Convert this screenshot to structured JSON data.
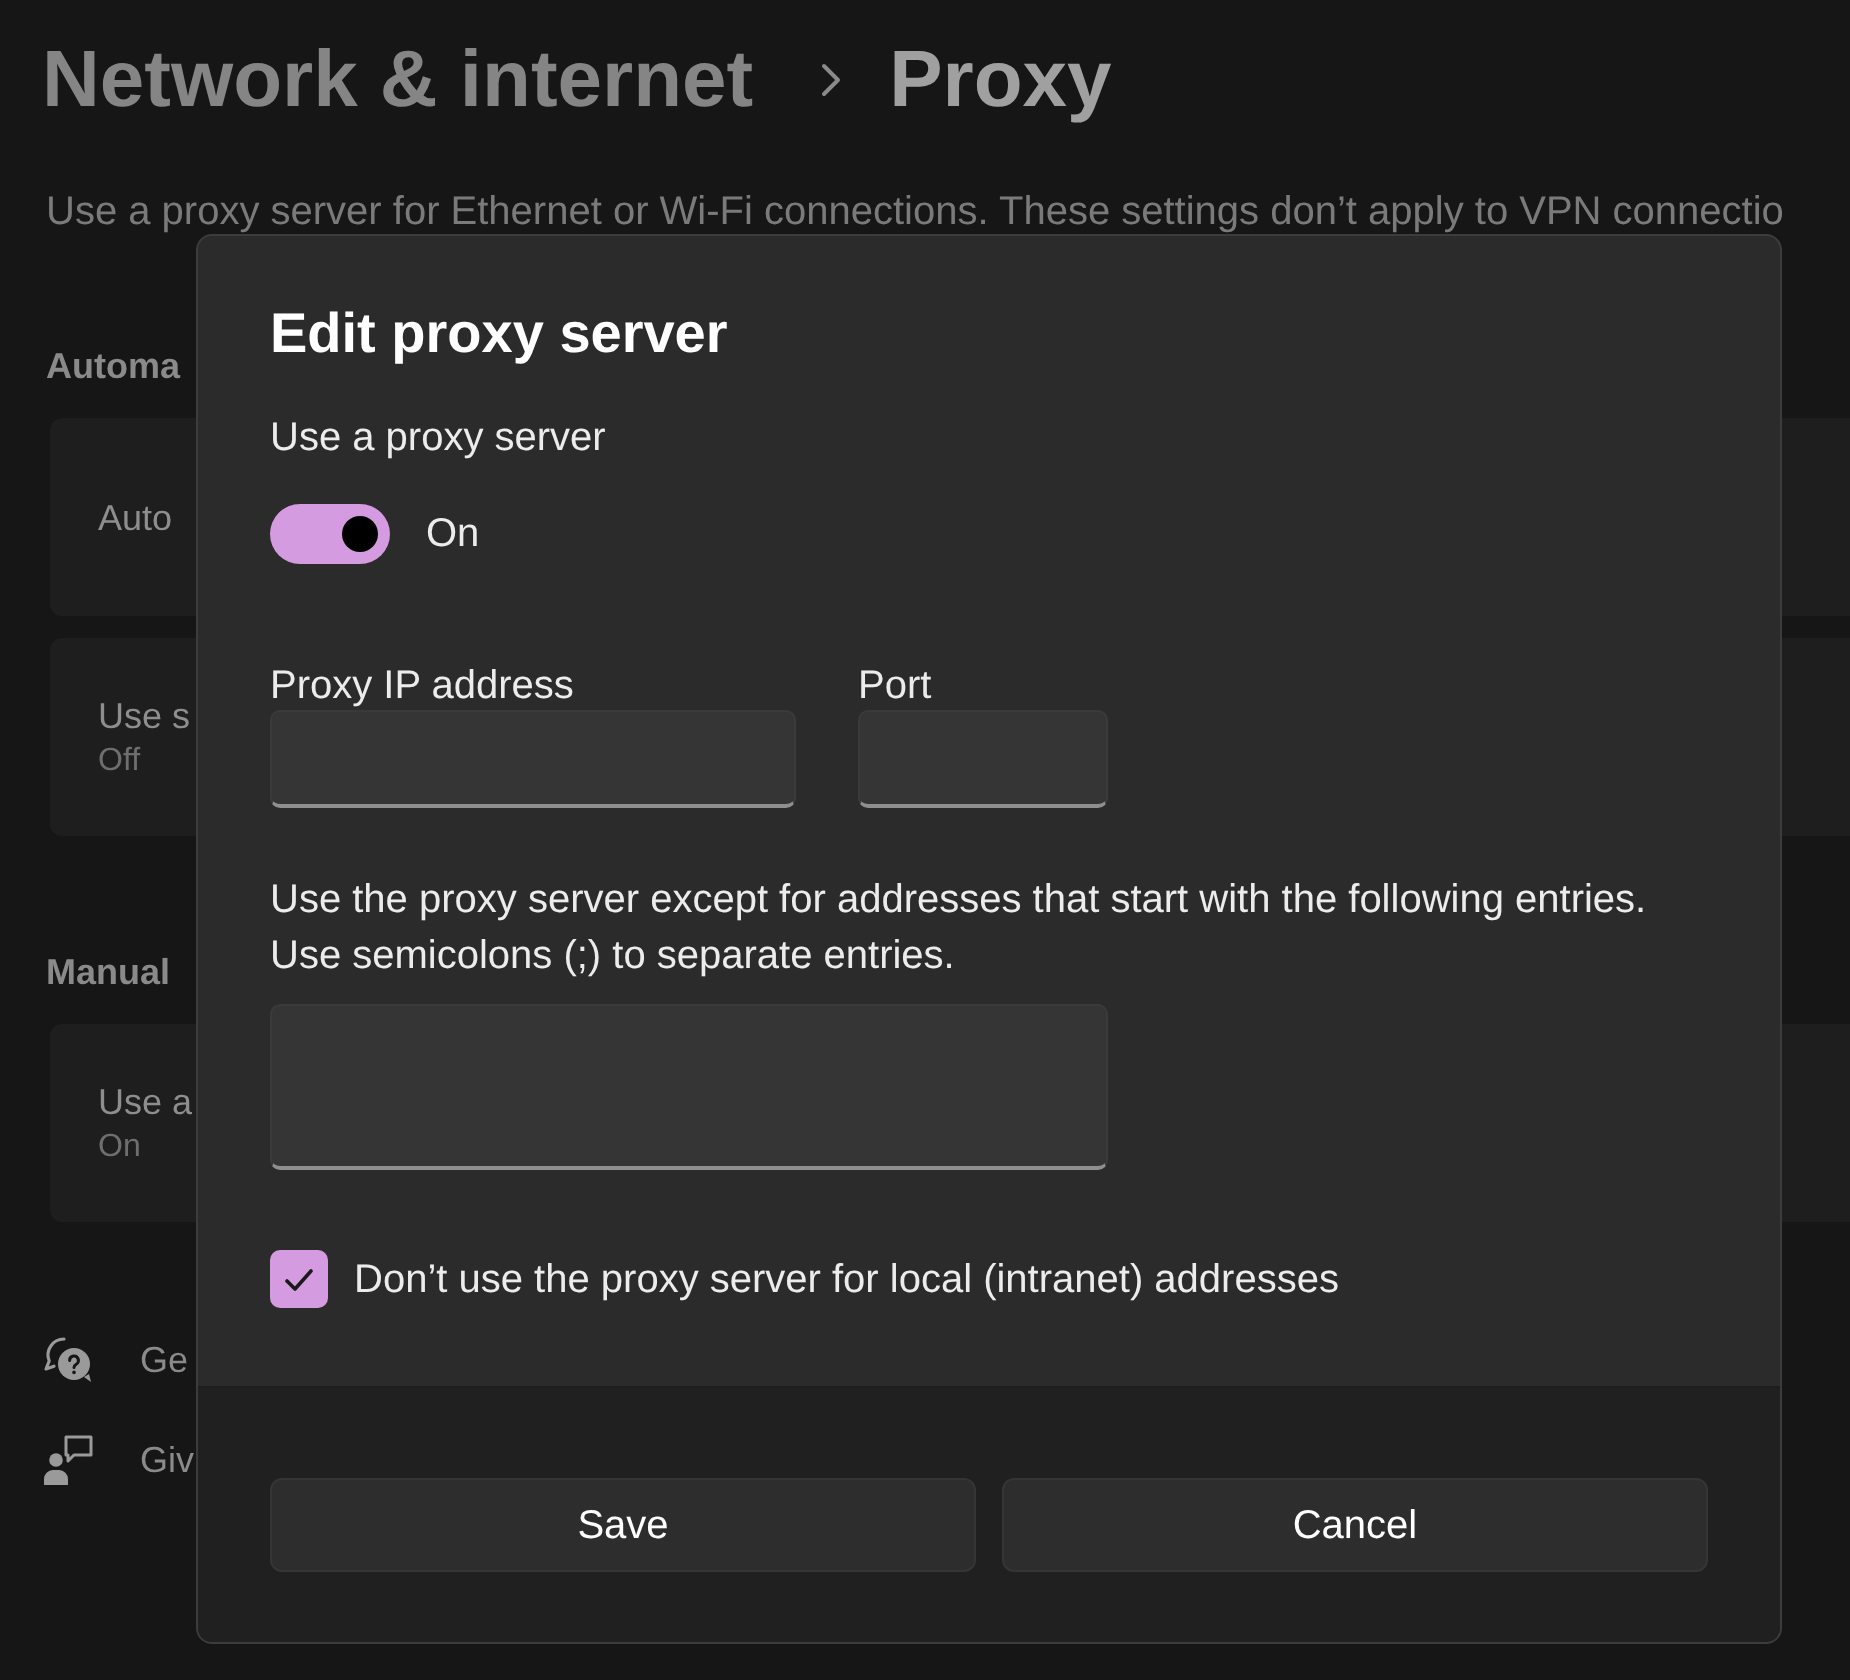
{
  "header": {
    "parent": "Network & internet",
    "current": "Proxy"
  },
  "description": "Use a proxy server for Ethernet or Wi-Fi connections. These settings don’t apply to VPN connectio",
  "sections": [
    {
      "heading": "Automa",
      "cards": [
        {
          "title": "Auto"
        },
        {
          "title": "Use s",
          "status": "Off"
        }
      ]
    },
    {
      "heading": "Manual",
      "cards": [
        {
          "title": "Use a",
          "status": "On"
        }
      ]
    }
  ],
  "links": [
    {
      "kind": "help",
      "label": "Ge"
    },
    {
      "kind": "feedback",
      "label": "Giv"
    }
  ],
  "dialog": {
    "title": "Edit proxy server",
    "toggle": {
      "label": "Use a proxy server",
      "on": true,
      "state_text": "On"
    },
    "fields": [
      {
        "label": "Proxy IP address"
      },
      {
        "label": "Port"
      }
    ],
    "exceptions": {
      "label": "Use the proxy server except for addresses that start with the following entries. Use semicolons (;) to separate entries."
    },
    "checkbox": {
      "label": "Don’t use the proxy server for local (intranet) addresses",
      "checked": true
    },
    "buttons": [
      {
        "label": "Save"
      },
      {
        "label": "Cancel"
      }
    ]
  }
}
